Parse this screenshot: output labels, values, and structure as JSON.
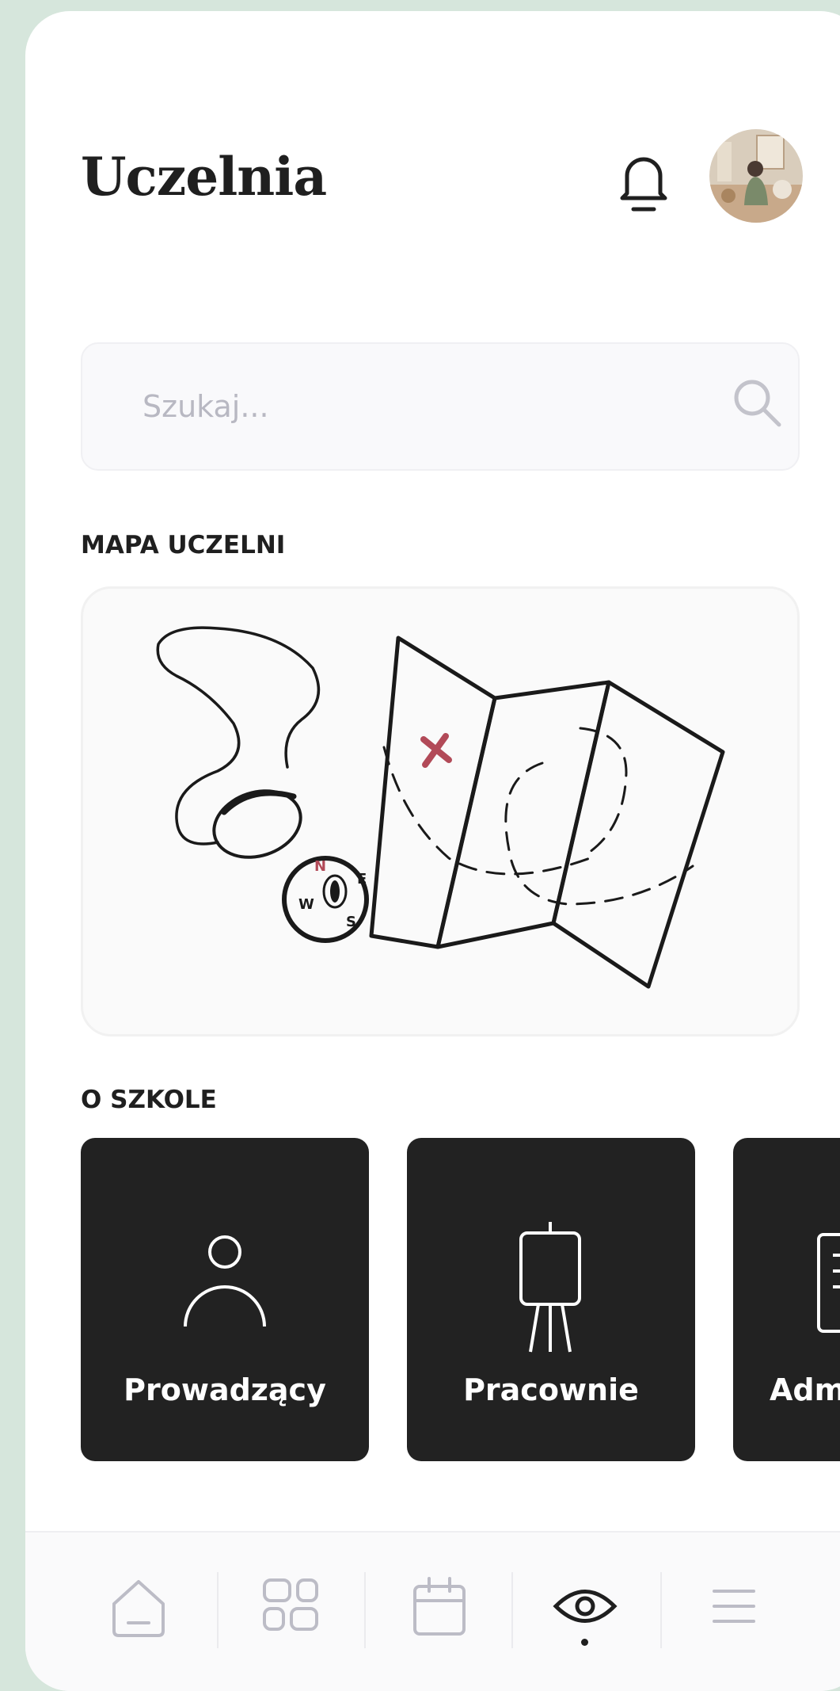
{
  "header": {
    "title": "Uczelnia"
  },
  "search": {
    "placeholder": "Szukaj..."
  },
  "sections": {
    "map_title": "MAPA UCZELNI",
    "about_title": "O SZKOLE"
  },
  "map": {
    "compass": {
      "n": "N",
      "e": "E",
      "s": "S",
      "w": "W"
    },
    "marker_color": "#b24a58"
  },
  "about_cards": [
    {
      "label": "Prowadzący",
      "icon": "person-icon"
    },
    {
      "label": "Pracownie",
      "icon": "easel-icon"
    },
    {
      "label": "Adm",
      "icon": "document-icon"
    }
  ],
  "nav": {
    "items": [
      "home-icon",
      "grid-icon",
      "calendar-icon",
      "eye-icon",
      "menu-icon"
    ],
    "active_index": 3
  },
  "colors": {
    "background": "#d6e6dc",
    "card_dark": "#222222",
    "nav_icon_inactive": "#bcbcc6",
    "nav_icon_active": "#1f1f1f"
  }
}
